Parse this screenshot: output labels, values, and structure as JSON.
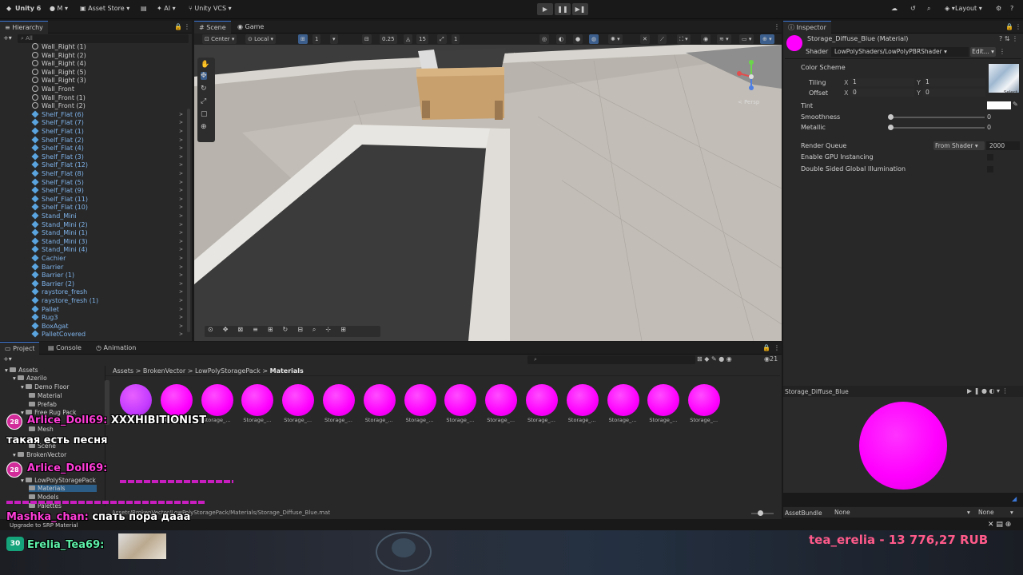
{
  "toolbar": {
    "app": "Unity 6",
    "account": "M",
    "asset_store": "Asset Store",
    "ai": "AI",
    "vcs": "Unity VCS",
    "layout": "Layout"
  },
  "hierarchy": {
    "tab": "Hierarchy",
    "search_placeholder": "All",
    "items": [
      {
        "label": "Wall_Right (1)",
        "kind": "plain"
      },
      {
        "label": "Wall_Right (2)",
        "kind": "plain"
      },
      {
        "label": "Wall_Right (4)",
        "kind": "plain"
      },
      {
        "label": "Wall_Right (5)",
        "kind": "plain"
      },
      {
        "label": "Wall_Right (3)",
        "kind": "plain"
      },
      {
        "label": "Wall_Front",
        "kind": "plain"
      },
      {
        "label": "Wall_Front (1)",
        "kind": "plain"
      },
      {
        "label": "Wall_Front (2)",
        "kind": "plain"
      },
      {
        "label": "Shelf_Flat (6)",
        "kind": "prefab"
      },
      {
        "label": "Shelf_Flat (7)",
        "kind": "prefab"
      },
      {
        "label": "Shelf_Flat (1)",
        "kind": "prefab"
      },
      {
        "label": "Shelf_Flat (2)",
        "kind": "prefab"
      },
      {
        "label": "Shelf_Flat (4)",
        "kind": "prefab"
      },
      {
        "label": "Shelf_Flat (3)",
        "kind": "prefab"
      },
      {
        "label": "Shelf_Flat (12)",
        "kind": "prefab"
      },
      {
        "label": "Shelf_Flat (8)",
        "kind": "prefab"
      },
      {
        "label": "Shelf_Flat (5)",
        "kind": "prefab"
      },
      {
        "label": "Shelf_Flat (9)",
        "kind": "prefab"
      },
      {
        "label": "Shelf_Flat (11)",
        "kind": "prefab"
      },
      {
        "label": "Shelf_Flat (10)",
        "kind": "prefab"
      },
      {
        "label": "Stand_Mini",
        "kind": "prefab"
      },
      {
        "label": "Stand_Mini (2)",
        "kind": "prefab"
      },
      {
        "label": "Stand_Mini (1)",
        "kind": "prefab"
      },
      {
        "label": "Stand_Mini (3)",
        "kind": "prefab"
      },
      {
        "label": "Stand_Mini (4)",
        "kind": "prefab"
      },
      {
        "label": "Cachier",
        "kind": "prefab"
      },
      {
        "label": "Barrier",
        "kind": "prefab"
      },
      {
        "label": "Barrier (1)",
        "kind": "prefab"
      },
      {
        "label": "Barrier (2)",
        "kind": "prefab"
      },
      {
        "label": "raystore_fresh",
        "kind": "prefab"
      },
      {
        "label": "raystore_fresh (1)",
        "kind": "prefab"
      },
      {
        "label": "Pallet",
        "kind": "prefab"
      },
      {
        "label": "Rug3",
        "kind": "prefab"
      },
      {
        "label": "BoxAgat",
        "kind": "prefab"
      },
      {
        "label": "PalletCovered",
        "kind": "prefab"
      }
    ]
  },
  "scene": {
    "tab_scene": "Scene",
    "tab_game": "Game",
    "pivot": "Center",
    "space": "Local",
    "grid_value": "1",
    "snap_value": "0.25",
    "angle_value": "15",
    "scale_value": "1",
    "gizmo_label": "< Persp"
  },
  "inspector": {
    "tab": "Inspector",
    "title": "Storage_Diffuse_Blue (Material)",
    "shader_label": "Shader",
    "shader_value": "LowPolyShaders/LowPolyPBRShader",
    "edit_button": "Edit...",
    "color_scheme": "Color Scheme",
    "tiling_label": "Tiling",
    "tiling_x": "1",
    "tiling_y": "1",
    "offset_label": "Offset",
    "offset_x": "0",
    "offset_y": "0",
    "x_axis": "X",
    "y_axis": "Y",
    "select_label": "Select",
    "tint_label": "Tint",
    "smoothness_label": "Smoothness",
    "smoothness_value": "0",
    "metallic_label": "Metallic",
    "metallic_value": "0",
    "render_queue_label": "Render Queue",
    "render_queue_mode": "From Shader",
    "render_queue_value": "2000",
    "gpu_instancing": "Enable GPU Instancing",
    "double_sided_gi": "Double Sided Global Illumination",
    "preview_title": "Storage_Diffuse_Blue",
    "assetbundle_label": "AssetBundle",
    "assetbundle_value": "None",
    "assetbundle_variant": "None"
  },
  "project": {
    "tab_project": "Project",
    "tab_console": "Console",
    "tab_animation": "Animation",
    "breadcrumb": [
      "Assets",
      "BrokenVector",
      "LowPolyStoragePack",
      "Materials"
    ],
    "asset_count": "21",
    "tree": [
      "Assets",
      "Azerilo",
      "Demo Floor",
      "Material",
      "Prefab",
      "Free Rug Pack",
      "Mesh",
      "Scene",
      "BrokenVector",
      "LowPolyStoragePack",
      "Materials",
      "Models",
      "Palettes"
    ],
    "assets_label": "Storage_...",
    "status_path": "Assets/BrokenVector/LowPolyStoragePack/Materials/Storage_Diffuse_Blue.mat",
    "upgrade": "Upgrade to SRP Material"
  },
  "chat": {
    "msg1_badge": "28",
    "msg1_user": "Arlice_Doll69:",
    "msg1_text": "XXXHIBITIONIST",
    "msg2_text": "такая есть песня",
    "msg3_badge": "28",
    "msg3_user": "Arlice_Doll69:",
    "msg4_user": "Mashka_chan:",
    "msg4_text": "спать пора дааа",
    "msg5_badge": "30",
    "msg5_user": "Erelia_Tea69:"
  },
  "donation": "tea_erelia - 13 776,27 RUB",
  "colors": {
    "accent": "#3b78d8",
    "material": "#ff00ff",
    "prefab_text": "#7fb3ea",
    "chat_name": "#ff3dd8",
    "donation": "#ff5a8a"
  }
}
